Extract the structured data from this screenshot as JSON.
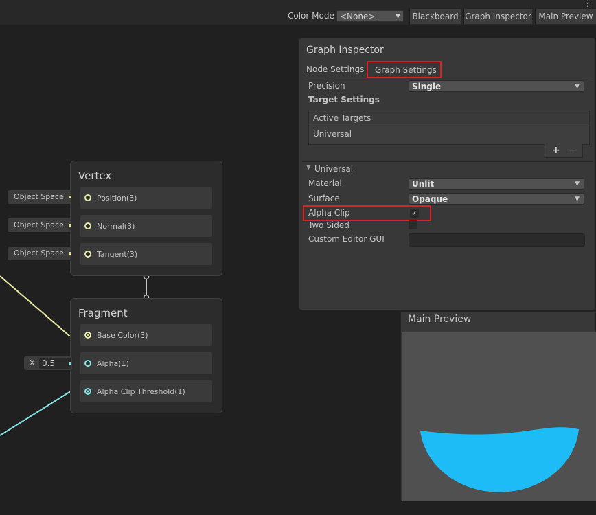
{
  "toolbar": {
    "more_icon": "⋮",
    "color_mode_label": "Color Mode",
    "color_mode_value": "<None>",
    "blackboard_label": "Blackboard",
    "graph_inspector_label": "Graph Inspector",
    "main_preview_label": "Main Preview"
  },
  "vertex_node": {
    "title": "Vertex",
    "ports": [
      {
        "label": "Position(3)",
        "input": "Object Space"
      },
      {
        "label": "Normal(3)",
        "input": "Object Space"
      },
      {
        "label": "Tangent(3)",
        "input": "Object Space"
      }
    ]
  },
  "fragment_node": {
    "title": "Fragment",
    "ports": [
      {
        "label": "Base Color(3)"
      },
      {
        "label": "Alpha(1)",
        "input_axis": "X",
        "input_value": "0.5"
      },
      {
        "label": "Alpha Clip Threshold(1)"
      }
    ]
  },
  "inspector": {
    "title": "Graph Inspector",
    "tabs": [
      "Node Settings",
      "Graph Settings"
    ],
    "active_tab": "Graph Settings",
    "precision_label": "Precision",
    "precision_value": "Single",
    "target_settings_label": "Target Settings",
    "active_targets_header": "Active Targets",
    "active_targets": [
      "Universal"
    ],
    "add_icon": "+",
    "remove_icon": "−",
    "section_label": "Universal",
    "material_label": "Material",
    "material_value": "Unlit",
    "surface_label": "Surface",
    "surface_value": "Opaque",
    "alpha_clip_label": "Alpha Clip",
    "alpha_clip_checked": true,
    "two_sided_label": "Two Sided",
    "two_sided_checked": false,
    "custom_editor_label": "Custom Editor GUI",
    "custom_editor_value": ""
  },
  "preview": {
    "title": "Main Preview",
    "shape_color": "#1ebcf6"
  },
  "colors": {
    "highlight": "#e02020",
    "vector3_wire": "#e8e8a0",
    "float_wire": "#84e4e7"
  }
}
